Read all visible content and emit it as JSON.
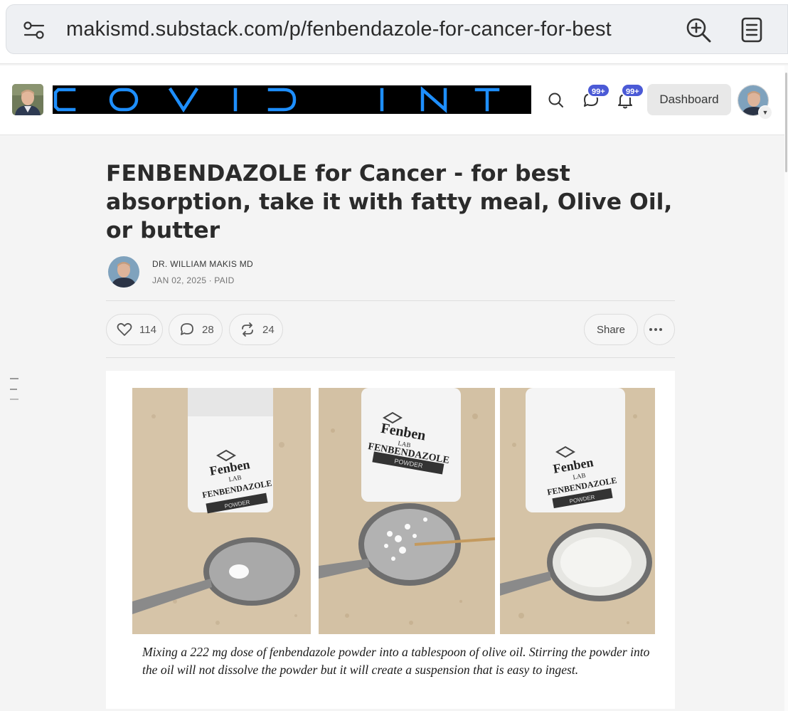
{
  "browser": {
    "url": "makismd.substack.com/p/fenbendazole-for-cancer-for-best",
    "icons": [
      "site-settings-icon",
      "zoom-in-icon",
      "reader-mode-icon"
    ]
  },
  "header": {
    "banner_text": "COVID INT",
    "chat_badge": "99+",
    "notifications_badge": "99+",
    "dashboard_label": "Dashboard",
    "accent_color": "#4b5ad6",
    "banner_letter_color": "#1e8fff"
  },
  "post": {
    "title": "FENBENDAZOLE for Cancer - for best absorption, take it with fatty meal, Olive Oil, or butter",
    "author": "DR. WILLIAM MAKIS MD",
    "meta": "JAN 02, 2025 ∙ PAID"
  },
  "actions": {
    "likes": "114",
    "comments": "28",
    "restacks": "24",
    "share_label": "Share"
  },
  "figure": {
    "photo_labels": {
      "brand": "Fenben",
      "lab": "LAB",
      "product": "FENBENDAZOLE",
      "form": "POWDER"
    },
    "caption": "Mixing a 222 mg dose of fenbendazole powder into a tablespoon of olive oil. Stirring the powder into the oil will not dissolve the powder but it will create a suspension that is easy to ingest."
  }
}
